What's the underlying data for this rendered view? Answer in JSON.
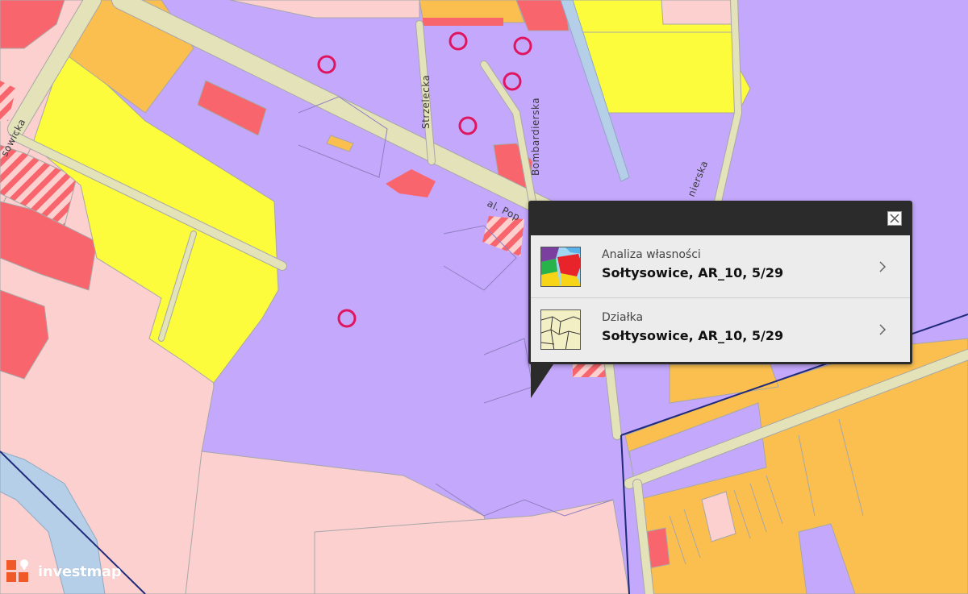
{
  "map": {
    "streets": {
      "strzelecka": "Strzelecka",
      "bombardierska": "Bombardierska",
      "al_pop": "al. Pop",
      "sowicka": "sowicka",
      "nierska": "nierska"
    }
  },
  "popup": {
    "items": [
      {
        "subtitle": "Analiza własności",
        "title": "Sołtysowice, AR_10, 5/29",
        "thumb_icon": "ownership-analysis-icon"
      },
      {
        "subtitle": "Działka",
        "title": "Sołtysowice, AR_10, 5/29",
        "thumb_icon": "parcel-map-icon"
      }
    ]
  },
  "brand": {
    "name": "investmap"
  },
  "colors": {
    "residential_pink": "#fdd0d0",
    "industrial_purple": "#c4a8fc",
    "yellow_zone": "#fcfc3c",
    "orange_zone": "#fbbf4f",
    "red_zone": "#f9656c",
    "road": "#e3e2b9",
    "water": "#b6cfe8",
    "popup_bg": "#2b2b2b",
    "accent": "#e0155f"
  }
}
